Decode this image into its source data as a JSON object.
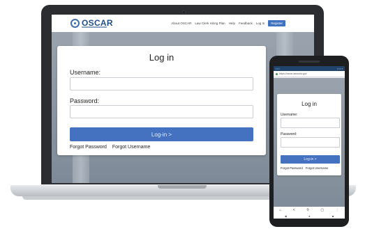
{
  "site": {
    "logo_text": "OSCAR",
    "nav_links": [
      "About OSCAR",
      "Law Clerk Hiring Plan",
      "Help",
      "Feedback",
      "Log In"
    ],
    "register_label": "Register",
    "brand_color": "#1f4e88",
    "accent_color": "#4472c0"
  },
  "login": {
    "title": "Log in",
    "username_label": "Username:",
    "password_label": "Password:",
    "submit_label": "Log-in >",
    "forgot_password": "Forgot Password",
    "forgot_username": "Forgot Username"
  },
  "mobile": {
    "url": "https://oscar.uscourts.gov",
    "toolbar_icons": [
      "home-icon",
      "share-icon",
      "search-icon",
      "tabs-icon",
      "menu-icon"
    ],
    "nav_icons": [
      "back-icon",
      "home-circle-icon",
      "recents-icon"
    ]
  }
}
